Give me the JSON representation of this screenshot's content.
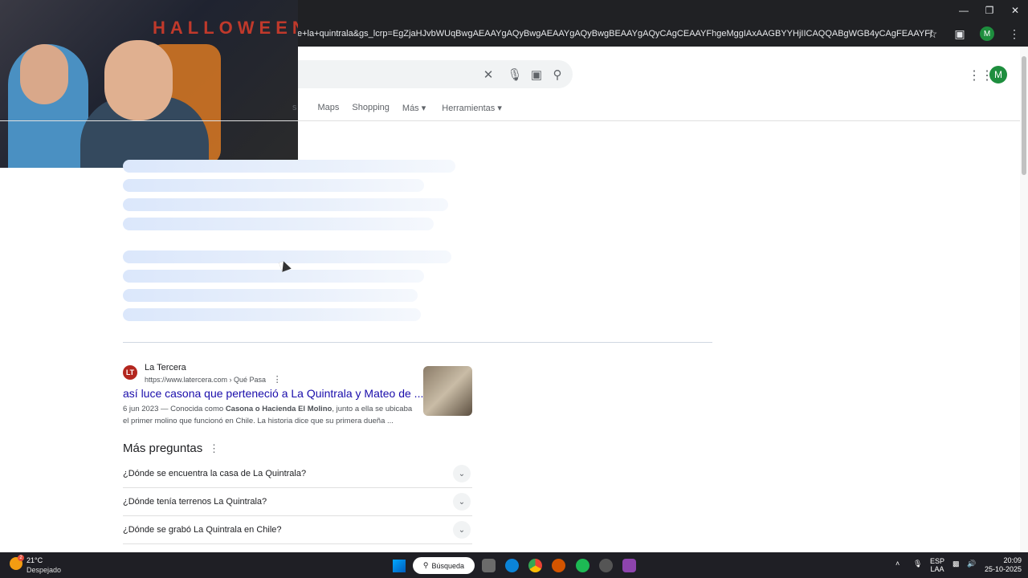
{
  "browser": {
    "url_fragment": "e+la+quintrala&gs_lcrp=EgZjaHJvbWUqBwgAEAAYgAQyBwgAEAAYgAQyBwgBEAAYgAQyCAgCEAAYFhgeMggIAxAAGBYYHjIICAQQABgWGB4yCAgFEAAYFhgeMggIBhAAGBYYHjIICAcQABgW...",
    "profile_initial": "M"
  },
  "webcam": {
    "sign_text": "HALLOWEEN"
  },
  "google": {
    "account_initial": "M",
    "tabs": [
      "Maps",
      "Shopping",
      "Más",
      "Herramientas"
    ],
    "tabs_truncated_prefix": "s"
  },
  "result": {
    "favicon_text": "LT",
    "site_name": "La Tercera",
    "url": "https://www.latercera.com › Qué Pasa",
    "title": "así luce casona que perteneció a La Quintrala y Mateo de ...",
    "snippet_date": "6 jun 2023 —",
    "snippet_pre": " Conocida como ",
    "snippet_bold": "Casona o Hacienda El Molino",
    "snippet_post": ", junto a ella se ubicaba el primer molino que funcionó en Chile. La historia dice que su primera dueña ..."
  },
  "paa": {
    "title": "Más preguntas",
    "questions": [
      "¿Dónde se encuentra la casa de La Quintrala?",
      "¿Dónde tenía terrenos La Quintrala?",
      "¿Dónde se grabó La Quintrala en Chile?"
    ]
  },
  "taskbar": {
    "weather_badge": "2",
    "temperature": "21°C",
    "condition": "Despejado",
    "search_label": "Búsqueda",
    "lang_top": "ESP",
    "lang_bottom": "LAA",
    "time": "20:09",
    "date": "25-10-2025"
  },
  "colors": {
    "chrome_dark": "#202124",
    "link_blue": "#1a0dab",
    "account_green": "#1e8e3e",
    "skeleton": "#dbe7fb"
  }
}
